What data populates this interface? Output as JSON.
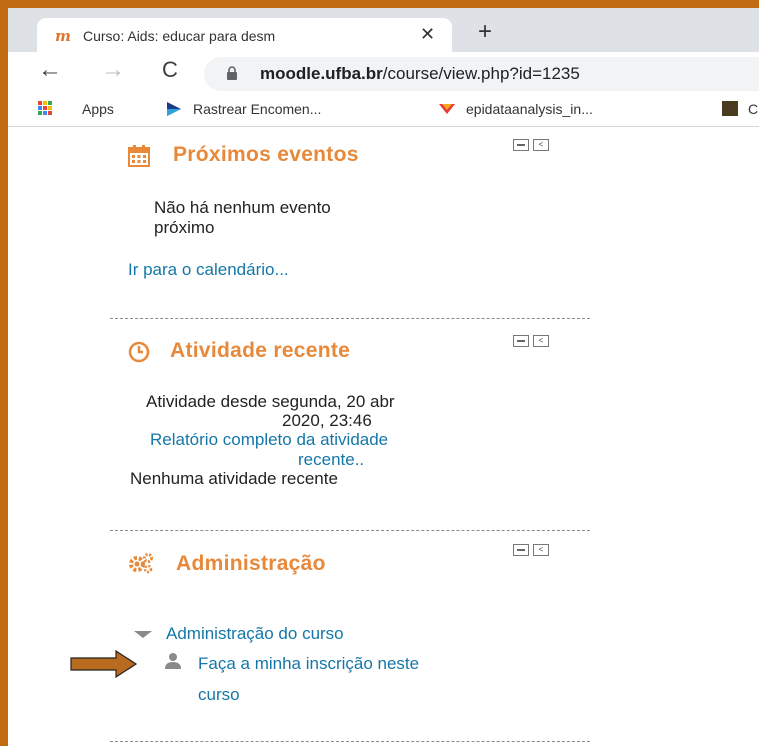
{
  "browser": {
    "tab_title": "Curso: Aids: educar para desm",
    "tab_close": "✕",
    "new_tab": "+",
    "back": "←",
    "forward": "→",
    "reload": "C",
    "url_host": "moodle.ufba.br",
    "url_path": "/course/view.php?id=1235",
    "bookmarks": {
      "apps": "Apps",
      "rastrear": "Rastrear Encomen...",
      "epidata": "epidataanalysis_in...",
      "last": "C"
    }
  },
  "upcoming_events": {
    "title": "Próximos eventos",
    "empty_line1": "Não há nenhum evento",
    "empty_line2": "próximo",
    "calendar_link": "Ir para o calendário..."
  },
  "recent_activity": {
    "title": "Atividade recente",
    "since_line1": "Atividade desde segunda, 20 abr",
    "since_line2": "2020, 23:46",
    "report_link_line1": "Relatório completo da atividade",
    "report_link_line2": "recente..",
    "empty": "Nenhuma atividade recente"
  },
  "administration": {
    "title": "Administração",
    "course_admin": "Administração do curso",
    "enrol_line1": "Faça a minha inscrição neste",
    "enrol_line2": "curso"
  },
  "colors": {
    "page_border": "#c06a12",
    "block_title": "#e8893a",
    "link": "#1577a8",
    "pointer_arrow": "#b86a1e"
  }
}
